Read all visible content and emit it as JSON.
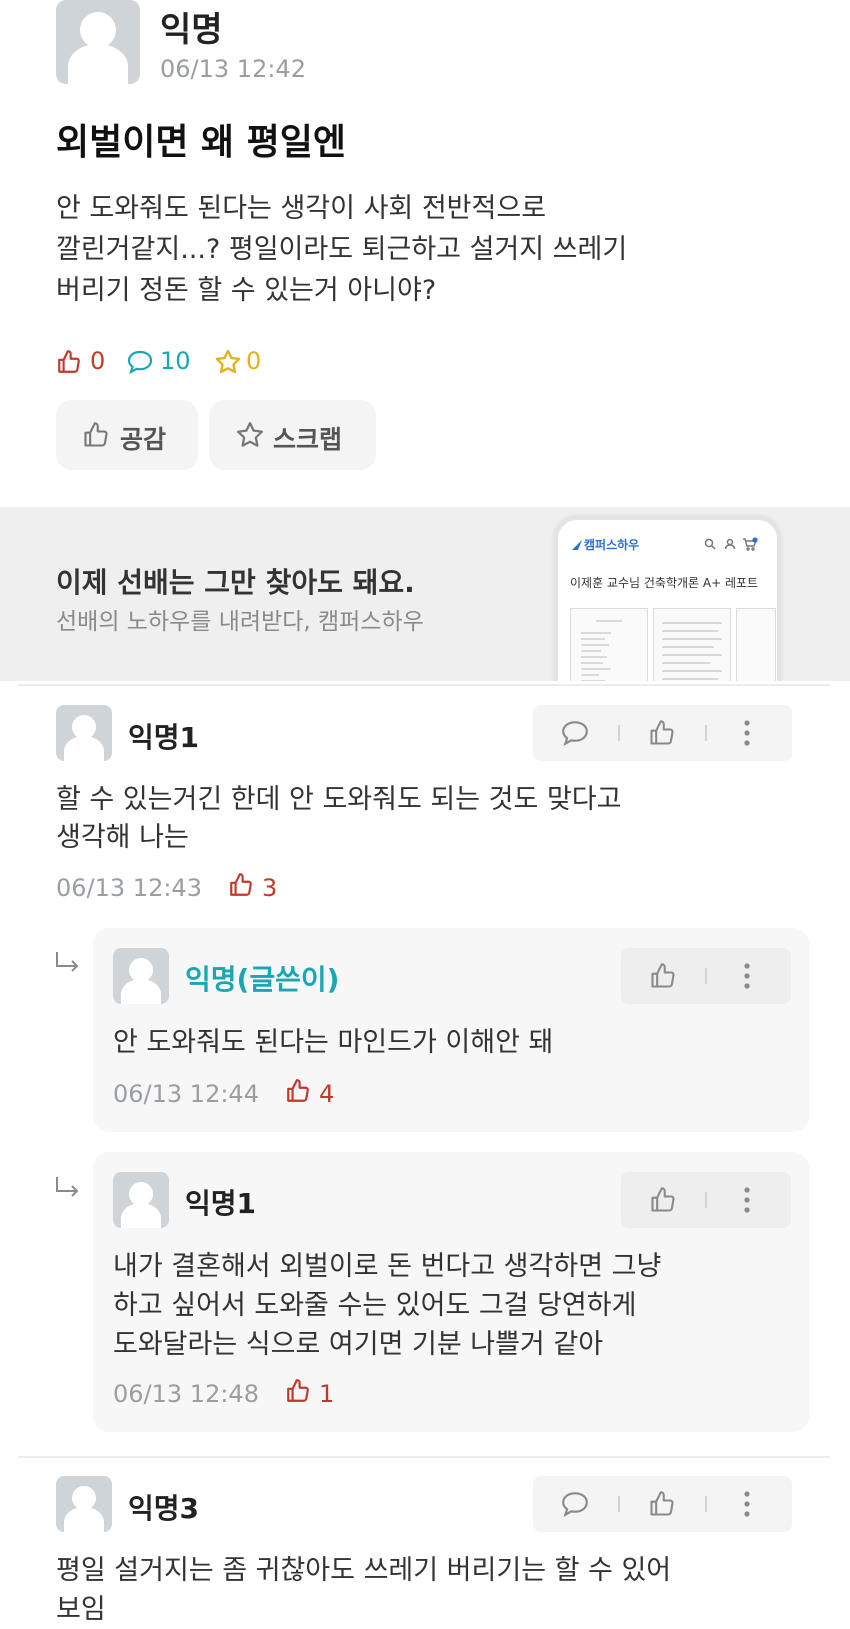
{
  "post": {
    "author": "익명",
    "time": "06/13 12:42",
    "title": "외벌이면 왜 평일엔",
    "body_lines": [
      "안 도와줘도 된다는 생각이 사회 전반적으로",
      "깔린거같지...? 평일이라도 퇴근하고 설거지 쓰레기",
      "버리기 정돈 할 수 있는거 아니야?"
    ],
    "stats": {
      "likes": "0",
      "comments": "10",
      "scraps": "0"
    },
    "buttons": {
      "like": "공감",
      "scrap": "스크랩"
    }
  },
  "ad": {
    "headline": "이제 선배는 그만 찾아도 돼요.",
    "subline": "선배의 노하우를 내려받다, 캠퍼스하우",
    "app_name": "캠퍼스하우",
    "doc_title": "이제훈 교수님 건축학개론 A+ 레포트"
  },
  "comments": [
    {
      "author": "익명1",
      "lines": [
        "할 수 있는거긴 한데 안 도와줘도 되는 것도 맞다고",
        "생각해 나는"
      ],
      "time": "06/13 12:43",
      "likes": "3"
    },
    {
      "author": "익명(글쓴이)",
      "lines": [
        "안 도와줘도 된다는 마인드가 이해안 돼"
      ],
      "time": "06/13 12:44",
      "likes": "4"
    },
    {
      "author": "익명1",
      "lines": [
        "내가 결혼해서 외벌이로 돈 번다고 생각하면 그냥",
        "하고 싶어서 도와줄 수는 있어도 그걸 당연하게",
        "도와달라는 식으로 여기면 기분 나쁠거 같아"
      ],
      "time": "06/13 12:48",
      "likes": "1"
    },
    {
      "author": "익명3",
      "lines": [
        "평일 설거지는 좀 귀찮아도 쓰레기 버리기는 할 수 있어",
        "보임"
      ]
    }
  ],
  "colors": {
    "like_red": "#c0392b",
    "comment_teal": "#1aa7b5",
    "scrap_yellow": "#e3b21a",
    "writer_teal": "#1aa7b5"
  }
}
